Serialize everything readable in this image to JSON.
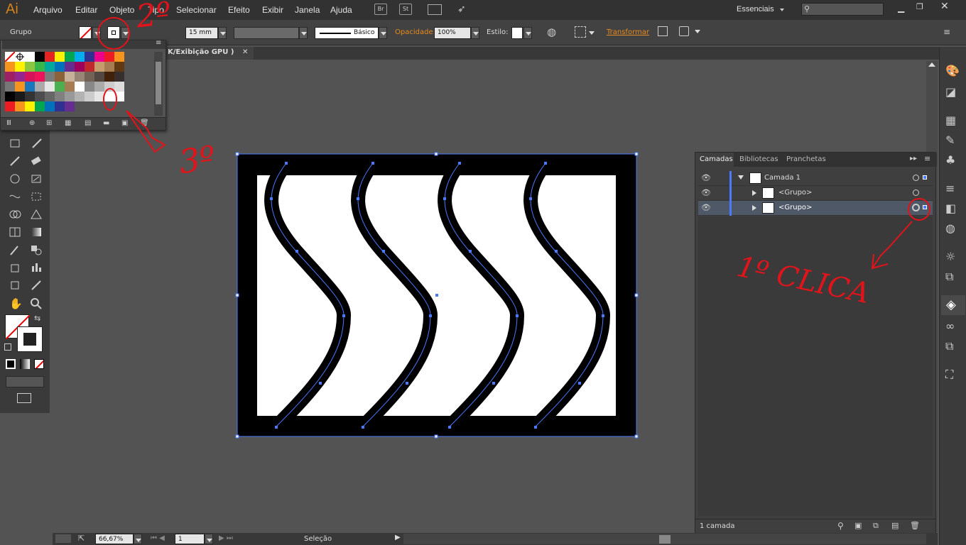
{
  "menubar": {
    "logo": "Ai",
    "items": [
      "Arquivo",
      "Editar",
      "Objeto",
      "Tipo",
      "Selecionar",
      "Efeito",
      "Exibir",
      "Janela",
      "Ajuda"
    ],
    "bridge_badge": "Br",
    "stock_badge": "St",
    "workspace": "Essenciais"
  },
  "controlbar": {
    "selection_type": "Grupo",
    "stroke_size": "15 mm",
    "brush_label": "Básico",
    "opacity_label": "Opacidade:",
    "opacity_value": "100%",
    "style_label": "Estilo:",
    "transform_label": "Transformar"
  },
  "document": {
    "tab_title": "K/Exibição GPU )"
  },
  "layers_panel": {
    "tabs": [
      "Camadas",
      "Bibliotecas",
      "Pranchetas"
    ],
    "rows": [
      {
        "name": "Camada 1"
      },
      {
        "name": "<Grupo>"
      },
      {
        "name": "<Grupo>"
      }
    ],
    "footer_count": "1 camada"
  },
  "statusbar": {
    "zoom": "66,67%",
    "artboard": "1",
    "tool": "Seleção"
  },
  "annotations": {
    "step1": "1º CLICA",
    "step2": "2º",
    "step3": "3º",
    "swatch_mark": "0"
  },
  "colors": {
    "accent": "#e88b1d",
    "selection": "#4b79ff",
    "annotation": "#e0141a"
  }
}
